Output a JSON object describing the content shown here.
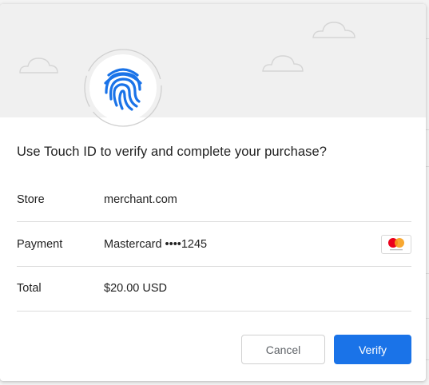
{
  "dialog": {
    "title": "Use Touch ID to verify and complete your purchase?",
    "rows": [
      {
        "label": "Store",
        "value": "merchant.com"
      },
      {
        "label": "Payment",
        "value": "Mastercard ••••1245",
        "icon": "mastercard-logo-icon"
      },
      {
        "label": "Total",
        "value": "$20.00 USD"
      }
    ],
    "buttons": {
      "cancel_label": "Cancel",
      "verify_label": "Verify"
    }
  },
  "icons": {
    "header": "fingerprint-icon",
    "decor": "cloud-icon"
  },
  "colors": {
    "accent": "#1a73e8",
    "header_band": "#f0f0f0",
    "mastercard_red": "#eb001b",
    "mastercard_orange": "#f79e1b"
  }
}
